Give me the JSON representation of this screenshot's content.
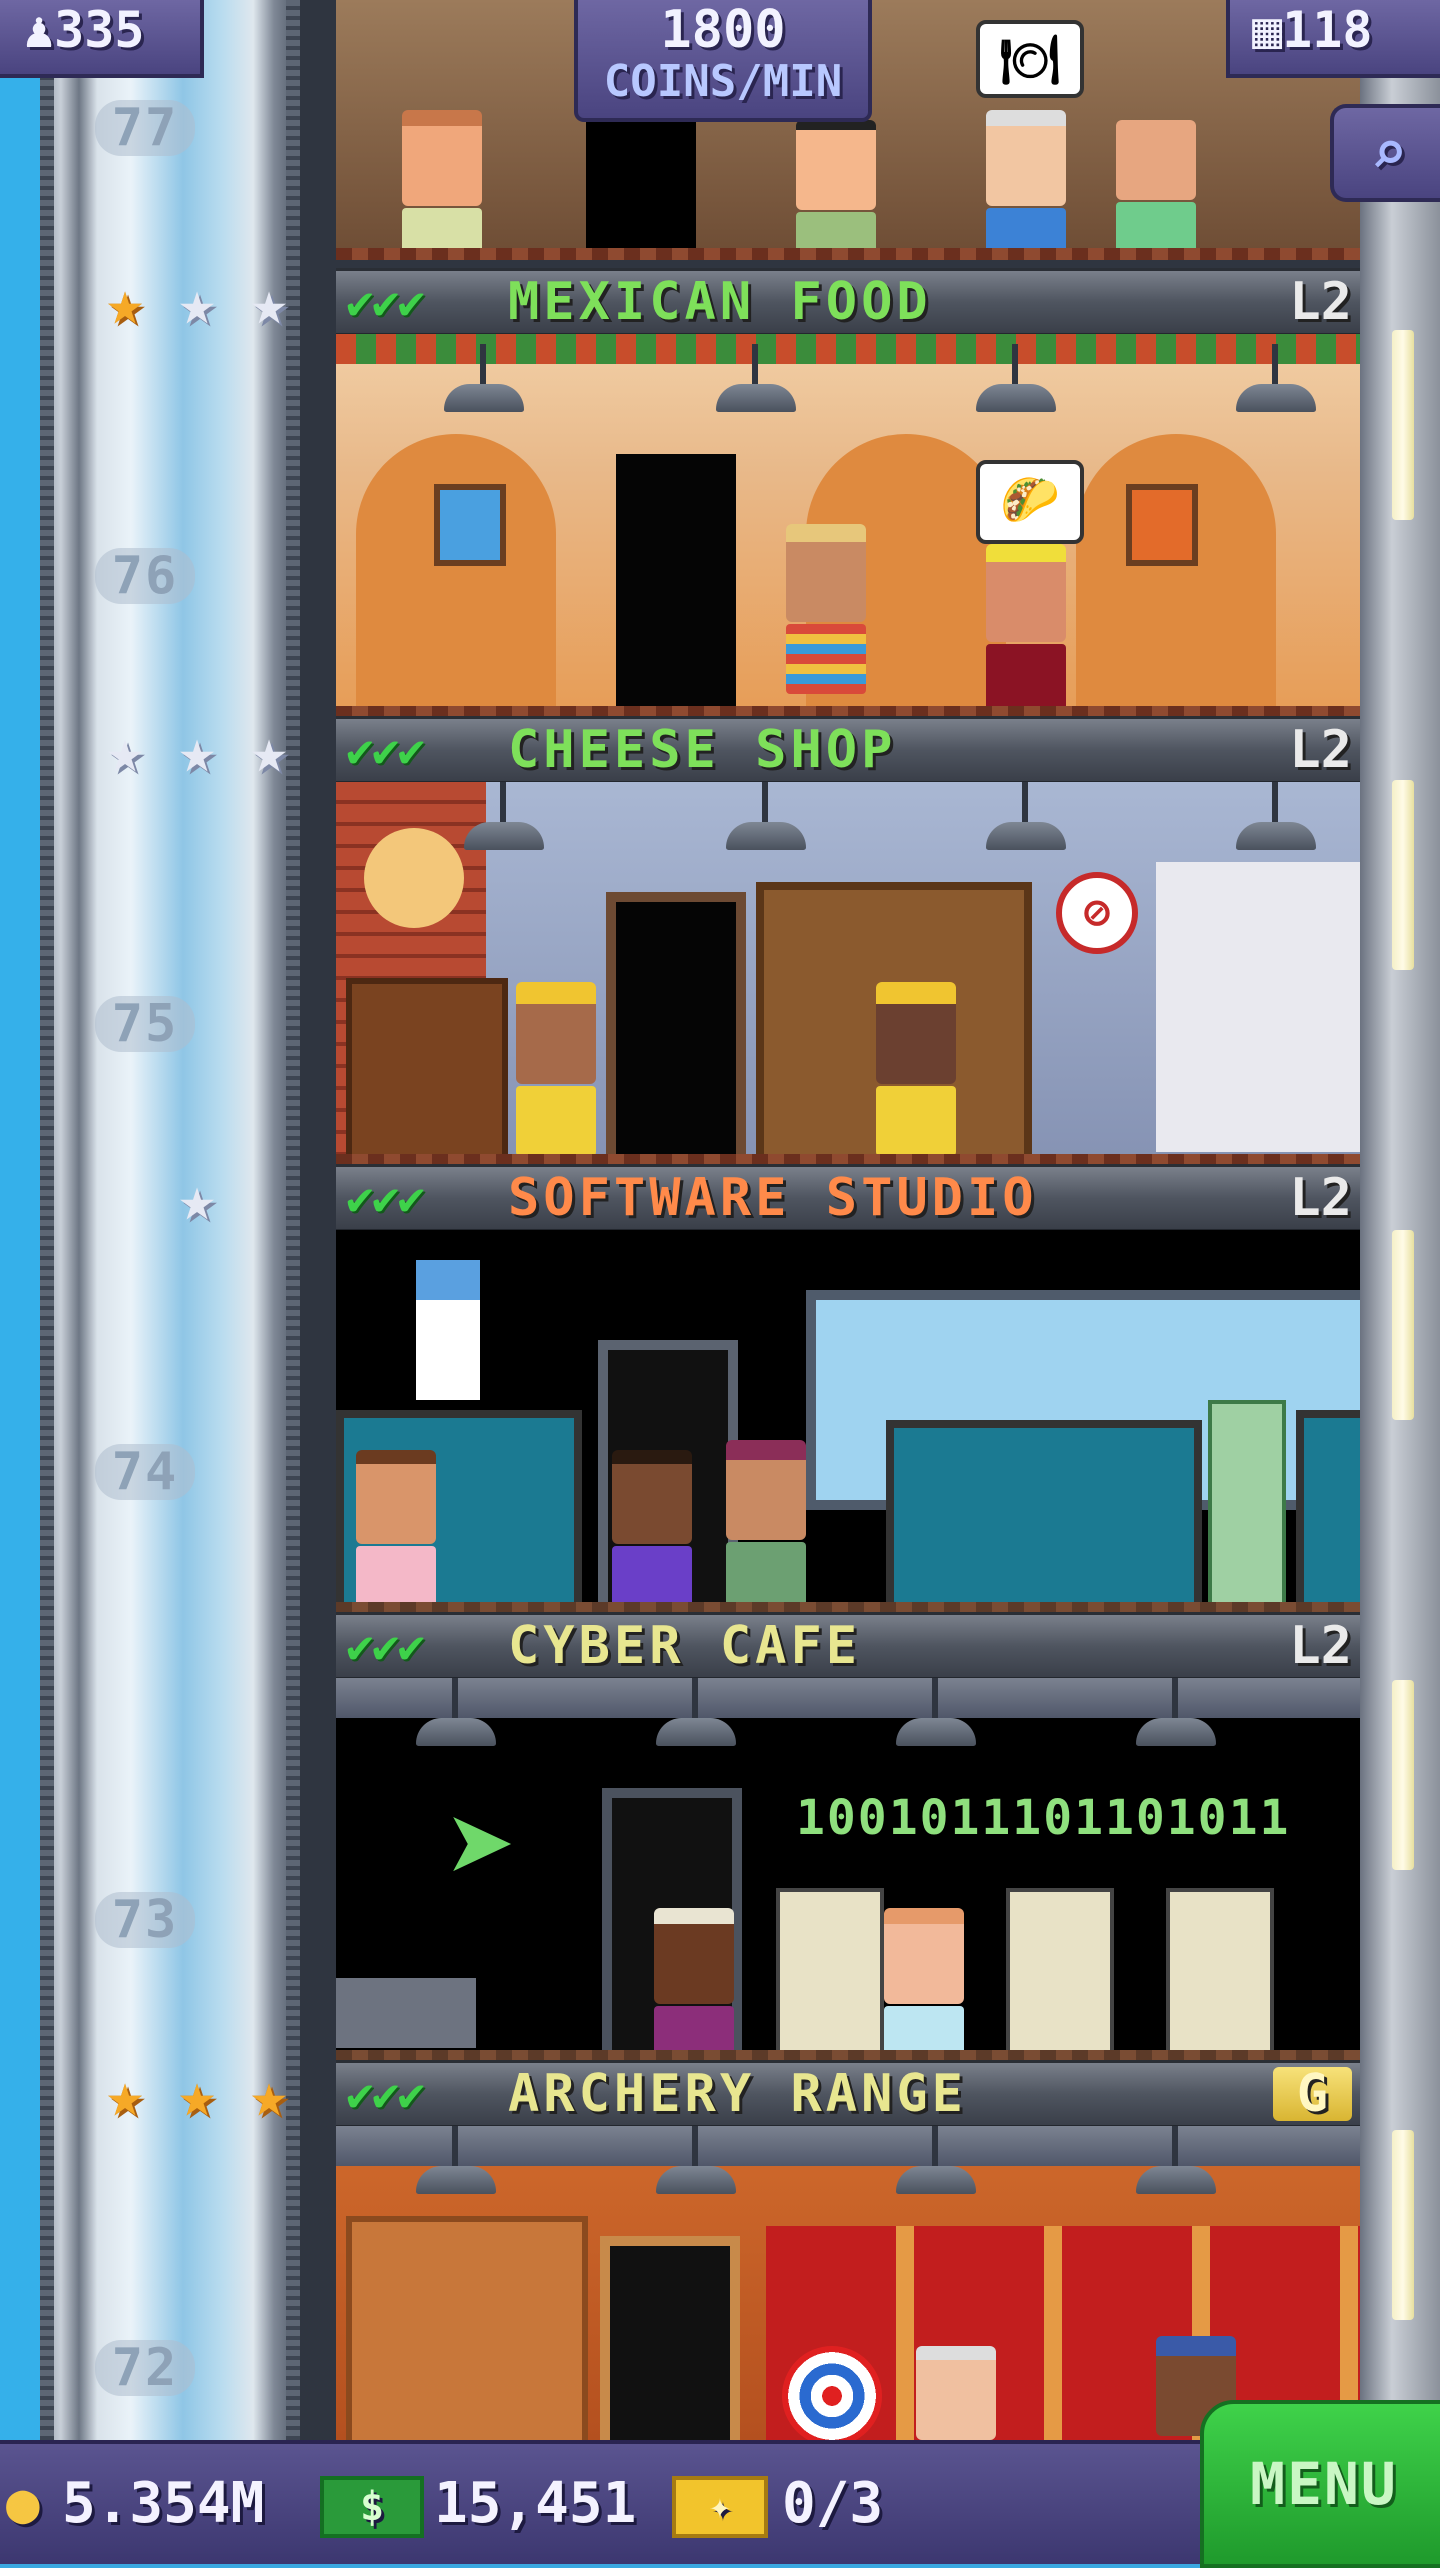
{
  "hud": {
    "population": "335",
    "coins_rate_line1": "1800",
    "coins_rate_line2": "COINS/MIN",
    "floors": "118"
  },
  "colors": {
    "mexican_food": "#7ee05a",
    "cheese_shop": "#7ee05a",
    "software_studio": "#ff8a4a",
    "cyber_cafe": "#e8e690",
    "archery_range": "#e8e690",
    "menu_green": "#2db83a"
  },
  "shaft_floor_numbers": [
    "77",
    "76",
    "75",
    "74",
    "73",
    "72"
  ],
  "floors": [
    {
      "name": "MEXICAN FOOD",
      "level": "L2",
      "checks": "✔✔✔",
      "stars": [
        "gold",
        "silver",
        "silver"
      ]
    },
    {
      "name": "CHEESE SHOP",
      "level": "L2",
      "checks": "✔✔✔",
      "stars": [
        "silver",
        "silver",
        "silver"
      ]
    },
    {
      "name": "SOFTWARE STUDIO",
      "level": "L2",
      "checks": "✔✔✔",
      "stars": [
        "silver"
      ]
    },
    {
      "name": "CYBER CAFE",
      "level": "L2",
      "checks": "✔✔✔",
      "stars": []
    },
    {
      "name": "ARCHERY RANGE",
      "level": "G",
      "checks": "✔✔✔",
      "stars": [
        "gold",
        "gold",
        "gold"
      ]
    }
  ],
  "binary_display": "1001011101101011",
  "bottom": {
    "coins": "5.354M",
    "bux": "15,451",
    "tickets": "0/3",
    "menu_label": "MENU"
  },
  "icons": {
    "population": "person-icon",
    "floors": "building-icon",
    "search": "magnifier-icon",
    "coin": "coin-icon",
    "bux": "banknote-icon",
    "ticket": "golden-ticket-icon"
  }
}
